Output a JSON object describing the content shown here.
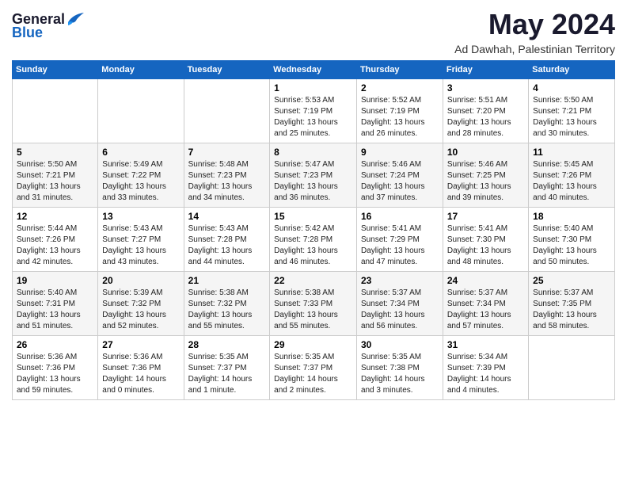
{
  "header": {
    "logo_general": "General",
    "logo_blue": "Blue",
    "title": "May 2024",
    "location": "Ad Dawhah, Palestinian Territory"
  },
  "weekdays": [
    "Sunday",
    "Monday",
    "Tuesday",
    "Wednesday",
    "Thursday",
    "Friday",
    "Saturday"
  ],
  "weeks": [
    [
      {
        "day": "",
        "info": ""
      },
      {
        "day": "",
        "info": ""
      },
      {
        "day": "",
        "info": ""
      },
      {
        "day": "1",
        "info": "Sunrise: 5:53 AM\nSunset: 7:19 PM\nDaylight: 13 hours\nand 25 minutes."
      },
      {
        "day": "2",
        "info": "Sunrise: 5:52 AM\nSunset: 7:19 PM\nDaylight: 13 hours\nand 26 minutes."
      },
      {
        "day": "3",
        "info": "Sunrise: 5:51 AM\nSunset: 7:20 PM\nDaylight: 13 hours\nand 28 minutes."
      },
      {
        "day": "4",
        "info": "Sunrise: 5:50 AM\nSunset: 7:21 PM\nDaylight: 13 hours\nand 30 minutes."
      }
    ],
    [
      {
        "day": "5",
        "info": "Sunrise: 5:50 AM\nSunset: 7:21 PM\nDaylight: 13 hours\nand 31 minutes."
      },
      {
        "day": "6",
        "info": "Sunrise: 5:49 AM\nSunset: 7:22 PM\nDaylight: 13 hours\nand 33 minutes."
      },
      {
        "day": "7",
        "info": "Sunrise: 5:48 AM\nSunset: 7:23 PM\nDaylight: 13 hours\nand 34 minutes."
      },
      {
        "day": "8",
        "info": "Sunrise: 5:47 AM\nSunset: 7:23 PM\nDaylight: 13 hours\nand 36 minutes."
      },
      {
        "day": "9",
        "info": "Sunrise: 5:46 AM\nSunset: 7:24 PM\nDaylight: 13 hours\nand 37 minutes."
      },
      {
        "day": "10",
        "info": "Sunrise: 5:46 AM\nSunset: 7:25 PM\nDaylight: 13 hours\nand 39 minutes."
      },
      {
        "day": "11",
        "info": "Sunrise: 5:45 AM\nSunset: 7:26 PM\nDaylight: 13 hours\nand 40 minutes."
      }
    ],
    [
      {
        "day": "12",
        "info": "Sunrise: 5:44 AM\nSunset: 7:26 PM\nDaylight: 13 hours\nand 42 minutes."
      },
      {
        "day": "13",
        "info": "Sunrise: 5:43 AM\nSunset: 7:27 PM\nDaylight: 13 hours\nand 43 minutes."
      },
      {
        "day": "14",
        "info": "Sunrise: 5:43 AM\nSunset: 7:28 PM\nDaylight: 13 hours\nand 44 minutes."
      },
      {
        "day": "15",
        "info": "Sunrise: 5:42 AM\nSunset: 7:28 PM\nDaylight: 13 hours\nand 46 minutes."
      },
      {
        "day": "16",
        "info": "Sunrise: 5:41 AM\nSunset: 7:29 PM\nDaylight: 13 hours\nand 47 minutes."
      },
      {
        "day": "17",
        "info": "Sunrise: 5:41 AM\nSunset: 7:30 PM\nDaylight: 13 hours\nand 48 minutes."
      },
      {
        "day": "18",
        "info": "Sunrise: 5:40 AM\nSunset: 7:30 PM\nDaylight: 13 hours\nand 50 minutes."
      }
    ],
    [
      {
        "day": "19",
        "info": "Sunrise: 5:40 AM\nSunset: 7:31 PM\nDaylight: 13 hours\nand 51 minutes."
      },
      {
        "day": "20",
        "info": "Sunrise: 5:39 AM\nSunset: 7:32 PM\nDaylight: 13 hours\nand 52 minutes."
      },
      {
        "day": "21",
        "info": "Sunrise: 5:38 AM\nSunset: 7:32 PM\nDaylight: 13 hours\nand 55 minutes."
      },
      {
        "day": "22",
        "info": "Sunrise: 5:38 AM\nSunset: 7:33 PM\nDaylight: 13 hours\nand 55 minutes."
      },
      {
        "day": "23",
        "info": "Sunrise: 5:37 AM\nSunset: 7:34 PM\nDaylight: 13 hours\nand 56 minutes."
      },
      {
        "day": "24",
        "info": "Sunrise: 5:37 AM\nSunset: 7:34 PM\nDaylight: 13 hours\nand 57 minutes."
      },
      {
        "day": "25",
        "info": "Sunrise: 5:37 AM\nSunset: 7:35 PM\nDaylight: 13 hours\nand 58 minutes."
      }
    ],
    [
      {
        "day": "26",
        "info": "Sunrise: 5:36 AM\nSunset: 7:36 PM\nDaylight: 13 hours\nand 59 minutes."
      },
      {
        "day": "27",
        "info": "Sunrise: 5:36 AM\nSunset: 7:36 PM\nDaylight: 14 hours\nand 0 minutes."
      },
      {
        "day": "28",
        "info": "Sunrise: 5:35 AM\nSunset: 7:37 PM\nDaylight: 14 hours\nand 1 minute."
      },
      {
        "day": "29",
        "info": "Sunrise: 5:35 AM\nSunset: 7:37 PM\nDaylight: 14 hours\nand 2 minutes."
      },
      {
        "day": "30",
        "info": "Sunrise: 5:35 AM\nSunset: 7:38 PM\nDaylight: 14 hours\nand 3 minutes."
      },
      {
        "day": "31",
        "info": "Sunrise: 5:34 AM\nSunset: 7:39 PM\nDaylight: 14 hours\nand 4 minutes."
      },
      {
        "day": "",
        "info": ""
      }
    ]
  ]
}
